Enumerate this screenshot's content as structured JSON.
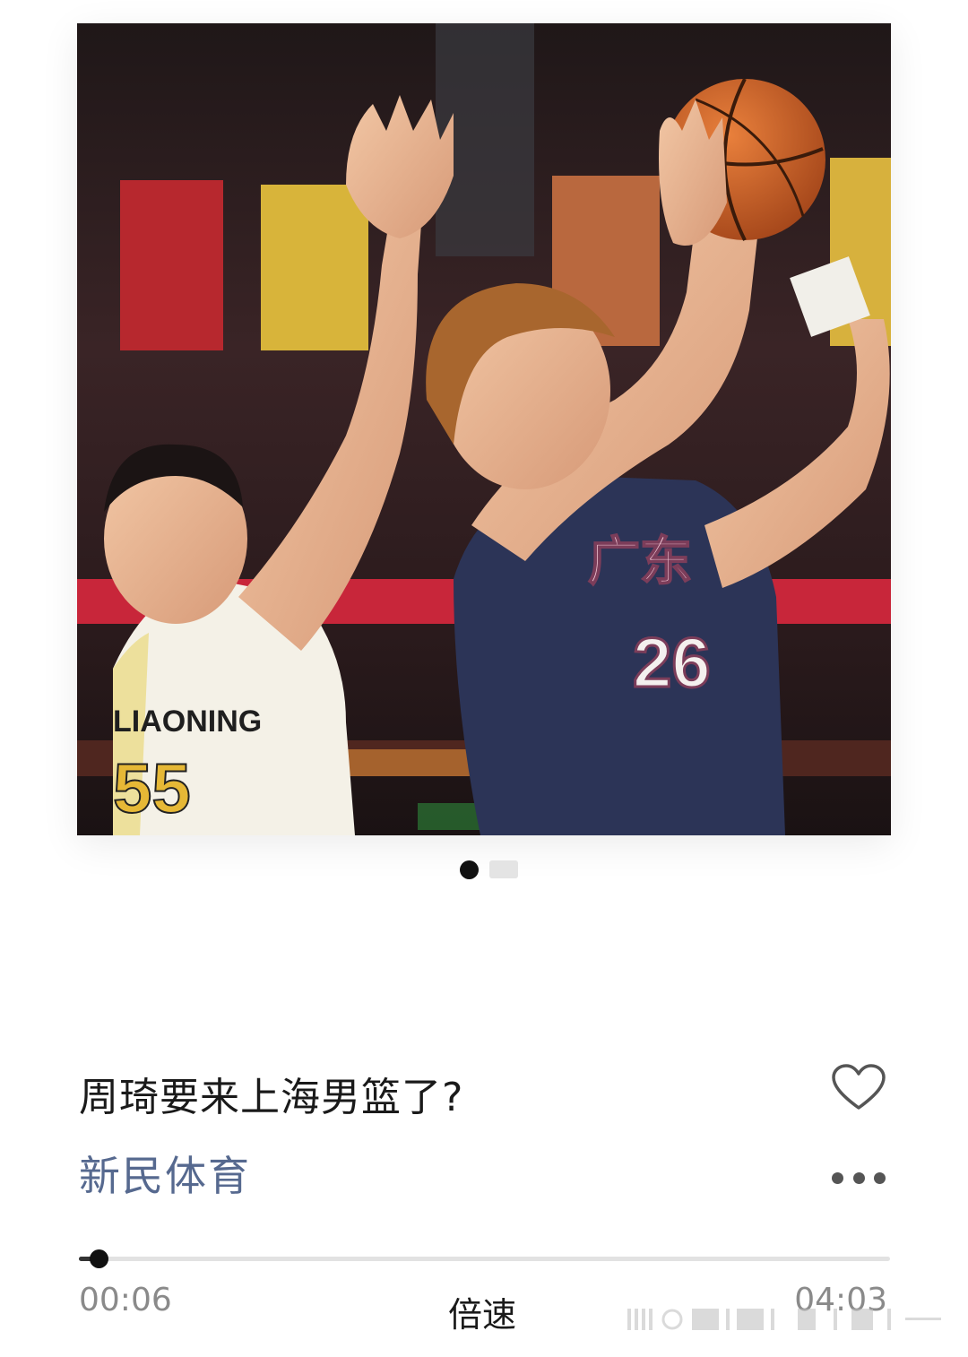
{
  "article": {
    "title": "周琦要来上海男篮了?",
    "author": "新民体育"
  },
  "cover": {
    "pager_count": 2,
    "pager_active_index": 0,
    "jersey_left_number": "55",
    "jersey_left_text": "LIAONING",
    "jersey_right_number": "26",
    "jersey_right_text": "广东"
  },
  "player": {
    "current_time": "00:06",
    "total_time": "04:03",
    "speed_label": "倍速",
    "progress_fraction": 0.024
  },
  "icons": {
    "like": "heart-icon",
    "more": "more-dots-icon"
  },
  "colors": {
    "author": "#56698f",
    "title": "#1a1a1a",
    "time": "#8a8a8a"
  }
}
